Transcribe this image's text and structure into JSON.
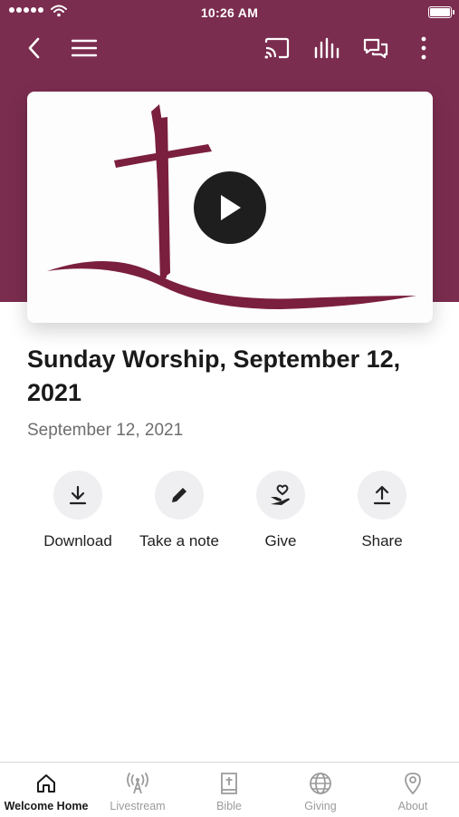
{
  "status_bar": {
    "time": "10:26 AM"
  },
  "toolbar": {
    "back_icon": "chevron-left-icon",
    "menu_icon": "hamburger-menu-icon",
    "cast_icon": "cast-icon",
    "audio_icon": "audio-bars-icon",
    "chat_icon": "chat-bubbles-icon",
    "more_icon": "more-vertical-icon"
  },
  "colors": {
    "brand": "#7b2d4f",
    "active_tab": "#1a1a1a",
    "inactive_tab": "#9b9b9b"
  },
  "media": {
    "title": "Sunday Worship, September 12, 2021",
    "date": "September 12, 2021",
    "play_icon": "play-icon"
  },
  "actions": [
    {
      "label": "Download",
      "icon": "download-icon"
    },
    {
      "label": "Take a note",
      "icon": "pencil-icon"
    },
    {
      "label": "Give",
      "icon": "heart-hand-icon"
    },
    {
      "label": "Share",
      "icon": "share-icon"
    }
  ],
  "tabs": [
    {
      "label": "Welcome Home",
      "icon": "home-icon",
      "active": true
    },
    {
      "label": "Livestream",
      "icon": "broadcast-icon",
      "active": false
    },
    {
      "label": "Bible",
      "icon": "bible-icon",
      "active": false
    },
    {
      "label": "Giving",
      "icon": "globe-icon",
      "active": false
    },
    {
      "label": "About",
      "icon": "location-pin-icon",
      "active": false
    }
  ]
}
